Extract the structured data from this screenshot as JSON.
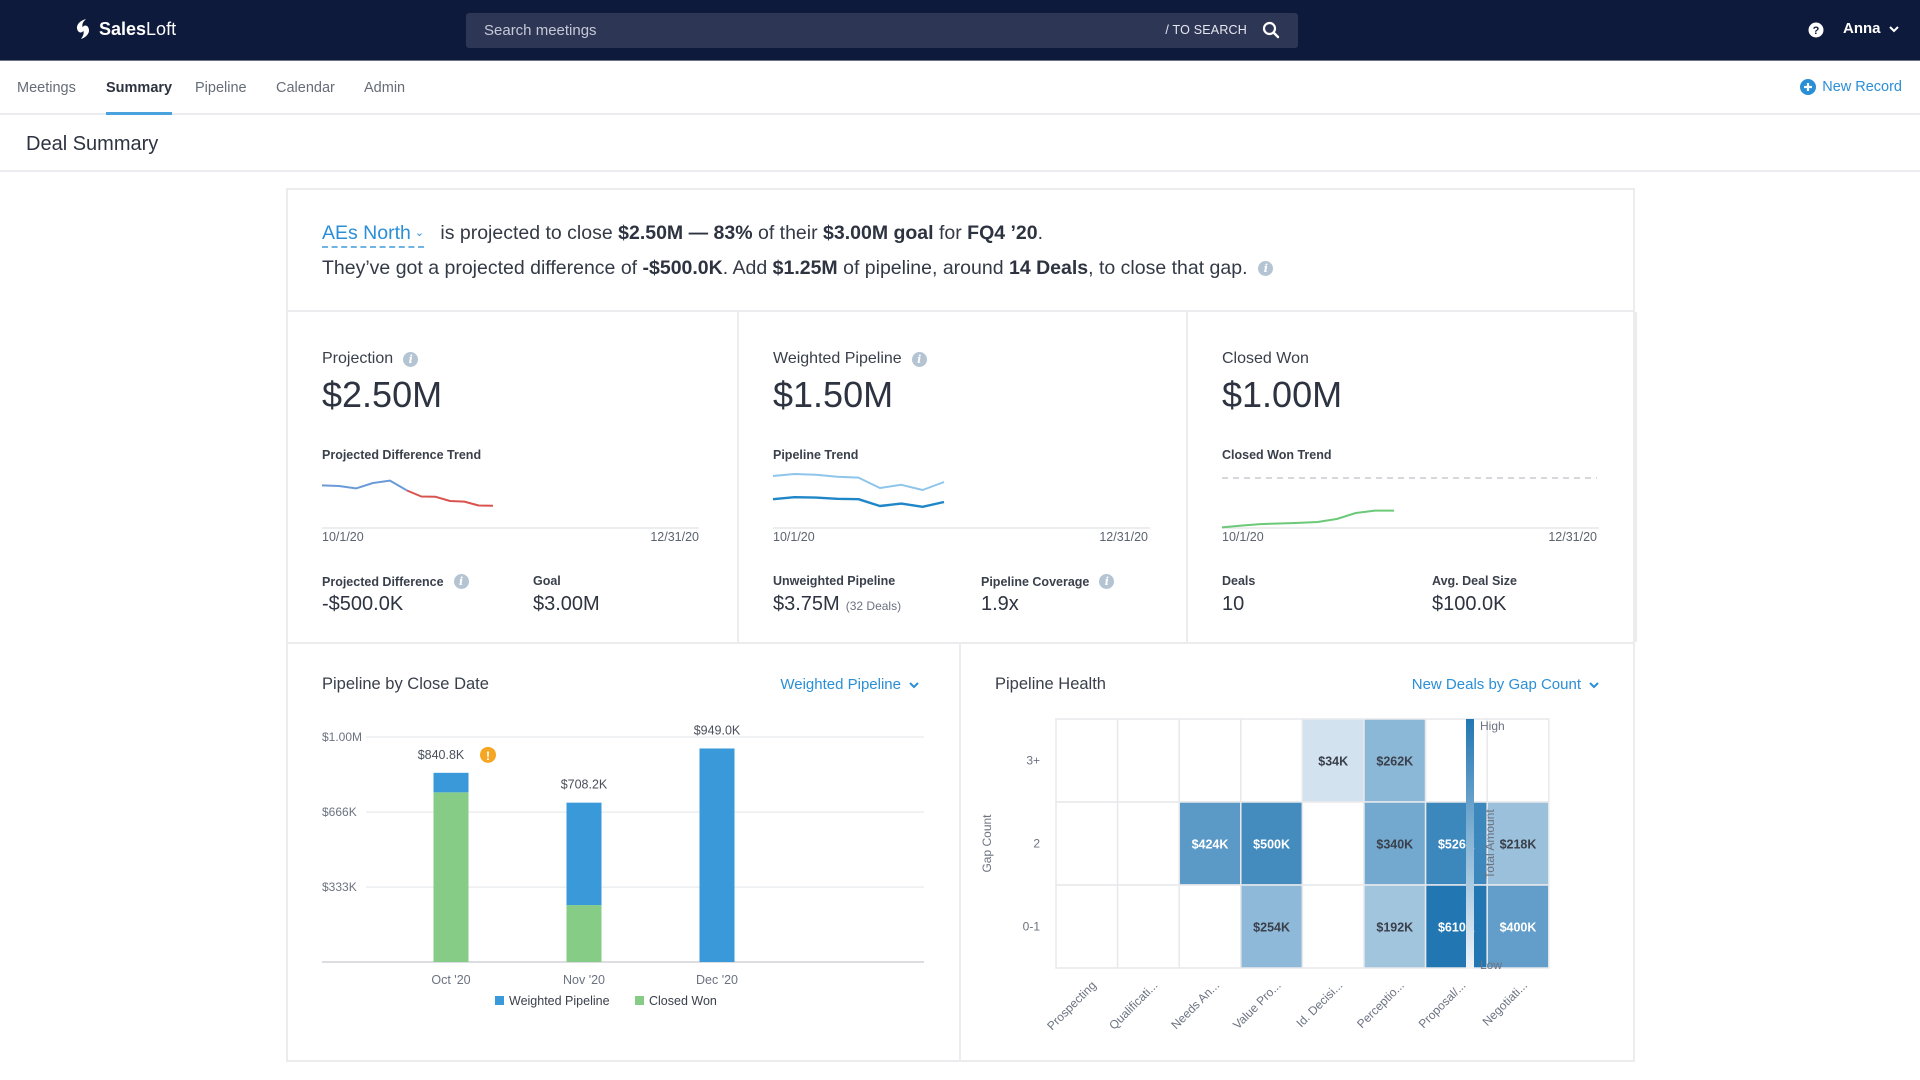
{
  "app": {
    "brand": "SalesLoft",
    "brand_bold": "Sales",
    "brand_light": "Loft",
    "search": {
      "placeholder": "Search meetings",
      "hint": "/ TO SEARCH"
    },
    "user": "Anna",
    "icons": {
      "logo": "salesloft-logo-icon",
      "search": "search-icon",
      "help": "help-circle-icon",
      "user_menu": "chevron-down-icon"
    }
  },
  "nav": {
    "items": [
      {
        "label": "Meetings",
        "active": false
      },
      {
        "label": "Summary",
        "active": true
      },
      {
        "label": "Pipeline",
        "active": false
      },
      {
        "label": "Calendar",
        "active": false
      },
      {
        "label": "Admin",
        "active": false
      }
    ],
    "new_record": "New Record"
  },
  "page": {
    "title": "Deal Summary"
  },
  "summary": {
    "team": "AEs North",
    "line1": {
      "t1": "is projected to close",
      "projected": "$2.50M",
      "dash": "—",
      "pct": "83%",
      "t2": "of their",
      "goal": "$3.00M goal",
      "t3": "for",
      "period": "FQ4 ’20",
      "end": "."
    },
    "line2": {
      "t1": "They’ve got a projected difference of",
      "diff": "-$500.0K",
      "t2": ". Add",
      "add": "$1.25M",
      "t3": "of pipeline, around",
      "deals": "14 Deals",
      "t4": ", to close that gap."
    }
  },
  "kpis": [
    {
      "label": "Projection",
      "info": true,
      "value": "$2.50M",
      "trend_label": "Projected Difference Trend",
      "date_start": "10/1/20",
      "date_end": "12/31/20",
      "sub": [
        {
          "label": "Projected Difference",
          "value": "-$500.0K",
          "info": true
        },
        {
          "label": "Goal",
          "value": "$3.00M"
        }
      ]
    },
    {
      "label": "Weighted Pipeline",
      "info": true,
      "value": "$1.50M",
      "trend_label": "Pipeline Trend",
      "date_start": "10/1/20",
      "date_end": "12/31/20",
      "sub": [
        {
          "label": "Unweighted Pipeline",
          "value": "$3.75M",
          "note": "(32 Deals)"
        },
        {
          "label": "Pipeline Coverage",
          "value": "1.9x",
          "info": true
        }
      ]
    },
    {
      "label": "Closed Won",
      "value": "$1.00M",
      "trend_label": "Closed Won Trend",
      "date_start": "10/1/20",
      "date_end": "12/31/20",
      "sub": [
        {
          "label": "Deals",
          "value": "10"
        },
        {
          "label": "Avg. Deal Size",
          "value": "$100.0K"
        }
      ]
    }
  ],
  "sparklines": {
    "projected_difference": {
      "positive": [
        0.72,
        0.7,
        0.62,
        0.8,
        0.88,
        0.55
      ],
      "negative": [
        0.55,
        0.35,
        0.34,
        0.2,
        0.18,
        0.05,
        0.04
      ],
      "colors": {
        "positive": "#6a9bd8",
        "negative": "#d9534f"
      }
    },
    "pipeline": {
      "unweighted": [
        0.9,
        0.95,
        0.93,
        0.88,
        0.86,
        0.6,
        0.68,
        0.55,
        0.75
      ],
      "weighted": [
        0.32,
        0.37,
        0.36,
        0.33,
        0.32,
        0.15,
        0.21,
        0.13,
        0.25
      ],
      "colors": {
        "unweighted": "#8ec5ea",
        "weighted": "#1f86c8"
      }
    },
    "closed_won": {
      "values": [
        0.02,
        0.08,
        0.13,
        0.15,
        0.17,
        0.2,
        0.3,
        0.5,
        0.58,
        0.58
      ],
      "goal_line": 1.0,
      "colors": {
        "line": "#6cc978",
        "goal": "#c9cbd0"
      }
    }
  },
  "pipeline_by_close_date": {
    "title": "Pipeline by Close Date",
    "dropdown": "Weighted Pipeline",
    "warning_icon": "warning-icon"
  },
  "pipeline_health": {
    "title": "Pipeline Health",
    "dropdown": "New Deals by Gap Count"
  },
  "chart_data": [
    {
      "type": "bar",
      "stacked": true,
      "title": "Pipeline by Close Date",
      "categories": [
        "Oct '20",
        "Nov '20",
        "Dec '20"
      ],
      "series": [
        {
          "name": "Closed Won",
          "color": "#86cc86",
          "values": [
            754000,
            253000,
            0
          ]
        },
        {
          "name": "Weighted Pipeline",
          "color": "#3a9ad9",
          "values": [
            86800,
            455200,
            949000
          ]
        }
      ],
      "totals": [
        "$840.8K",
        "$708.2K",
        "$949.0K"
      ],
      "warning_on": [
        true,
        false,
        false
      ],
      "yticks": [
        {
          "value": 0,
          "label": ""
        },
        {
          "value": 333000,
          "label": "$333K"
        },
        {
          "value": 666000,
          "label": "$666K"
        },
        {
          "value": 1000000,
          "label": "$1.00M"
        }
      ],
      "ylim": [
        0,
        1000000
      ],
      "grid": true,
      "legend": [
        "Weighted Pipeline",
        "Closed Won"
      ],
      "legend_position": "bottom"
    },
    {
      "type": "heatmap",
      "title": "Pipeline Health",
      "x": [
        "Prospecting",
        "Qualificati...",
        "Needs An...",
        "Value Pro...",
        "Id. Decisi...",
        "Perceptio...",
        "Proposal/...",
        "Negotiati..."
      ],
      "y": [
        "3+",
        "2",
        "0-1"
      ],
      "ylabel": "Gap Count",
      "cells": [
        [
          null,
          null,
          null,
          null,
          34,
          262,
          null,
          null
        ],
        [
          null,
          null,
          424,
          500,
          null,
          340,
          526,
          218
        ],
        [
          null,
          null,
          null,
          254,
          null,
          192,
          610,
          400
        ]
      ],
      "cell_labels": [
        [
          "",
          "",
          "",
          "",
          "$34K",
          "$262K",
          "",
          ""
        ],
        [
          "",
          "",
          "$424K",
          "$500K",
          "",
          "$340K",
          "$526K",
          "$218K"
        ],
        [
          "",
          "",
          "",
          "$254K",
          "",
          "$192K",
          "$610K",
          "$400K"
        ]
      ],
      "unit": "thousands USD",
      "colorbar": {
        "title": "Total Amount",
        "high": "High",
        "low": "Low",
        "high_color": "#2277b3",
        "low_color": "#f1f5f9"
      }
    }
  ]
}
